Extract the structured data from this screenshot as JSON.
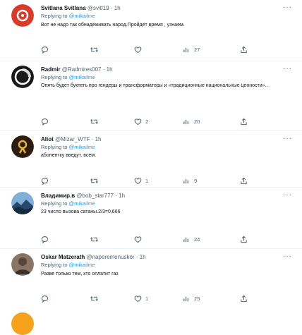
{
  "reply_prefix": "Replying to",
  "more_label": "···",
  "tweets": [
    {
      "name": "Svitlana Svitlana",
      "handle": "@svitl19",
      "dot": "·",
      "time": "1h",
      "replying_to": "@mikailme",
      "text": "Вот не надо так обнадёживать народ.Пройдёт время , узнаем.",
      "replies": "",
      "retweets": "",
      "likes": "",
      "views": "27",
      "avatar_icon": "red-circle-logo-avatar",
      "avatar_color": "#d93b28"
    },
    {
      "name": "Radmir",
      "handle": "@Radmires007",
      "dot": "·",
      "time": "1h",
      "replying_to": "@mikailme",
      "text": "Опять будет буктеть про гендеры и трансформаторы и «традиционные национальные ценности»..",
      "replies": "",
      "retweets": "",
      "likes": "2",
      "views": "20",
      "avatar_icon": "ring-logo-avatar",
      "avatar_color": "#1a1a1a"
    },
    {
      "name": "Aliot",
      "handle": "@Mizar_WTF",
      "dot": "·",
      "time": "1h",
      "replying_to": "@mikailme",
      "text": "абонентку введут. всем.",
      "replies": "",
      "retweets": "",
      "likes": "1",
      "views": "9",
      "avatar_icon": "yellow-glyph-avatar",
      "avatar_color": "#2b1d10"
    },
    {
      "name": "Владимир.в",
      "handle": "@bob_star777",
      "dot": "·",
      "time": "1h",
      "replying_to": "@mikailme",
      "text": "23 число вызова сатаны.2/3=0,666",
      "replies": "",
      "retweets": "",
      "likes": "",
      "views": "24",
      "avatar_icon": "mountain-photo-avatar",
      "avatar_color": "#26486a"
    },
    {
      "name": "Oskar Matzerath",
      "handle": "@naperemenuskor",
      "dot": "·",
      "time": "1h",
      "replying_to": "@mikailme",
      "text": "Разве только тем, кто оплатит газ",
      "replies": "",
      "retweets": "",
      "likes": "1",
      "views": "25",
      "avatar_icon": "portrait-photo-avatar",
      "avatar_color": "#55463c"
    }
  ],
  "colors": {
    "text_primary": "#0f1419",
    "text_secondary": "#536471",
    "link": "#1d9bf0",
    "divider": "#eff3f4"
  }
}
